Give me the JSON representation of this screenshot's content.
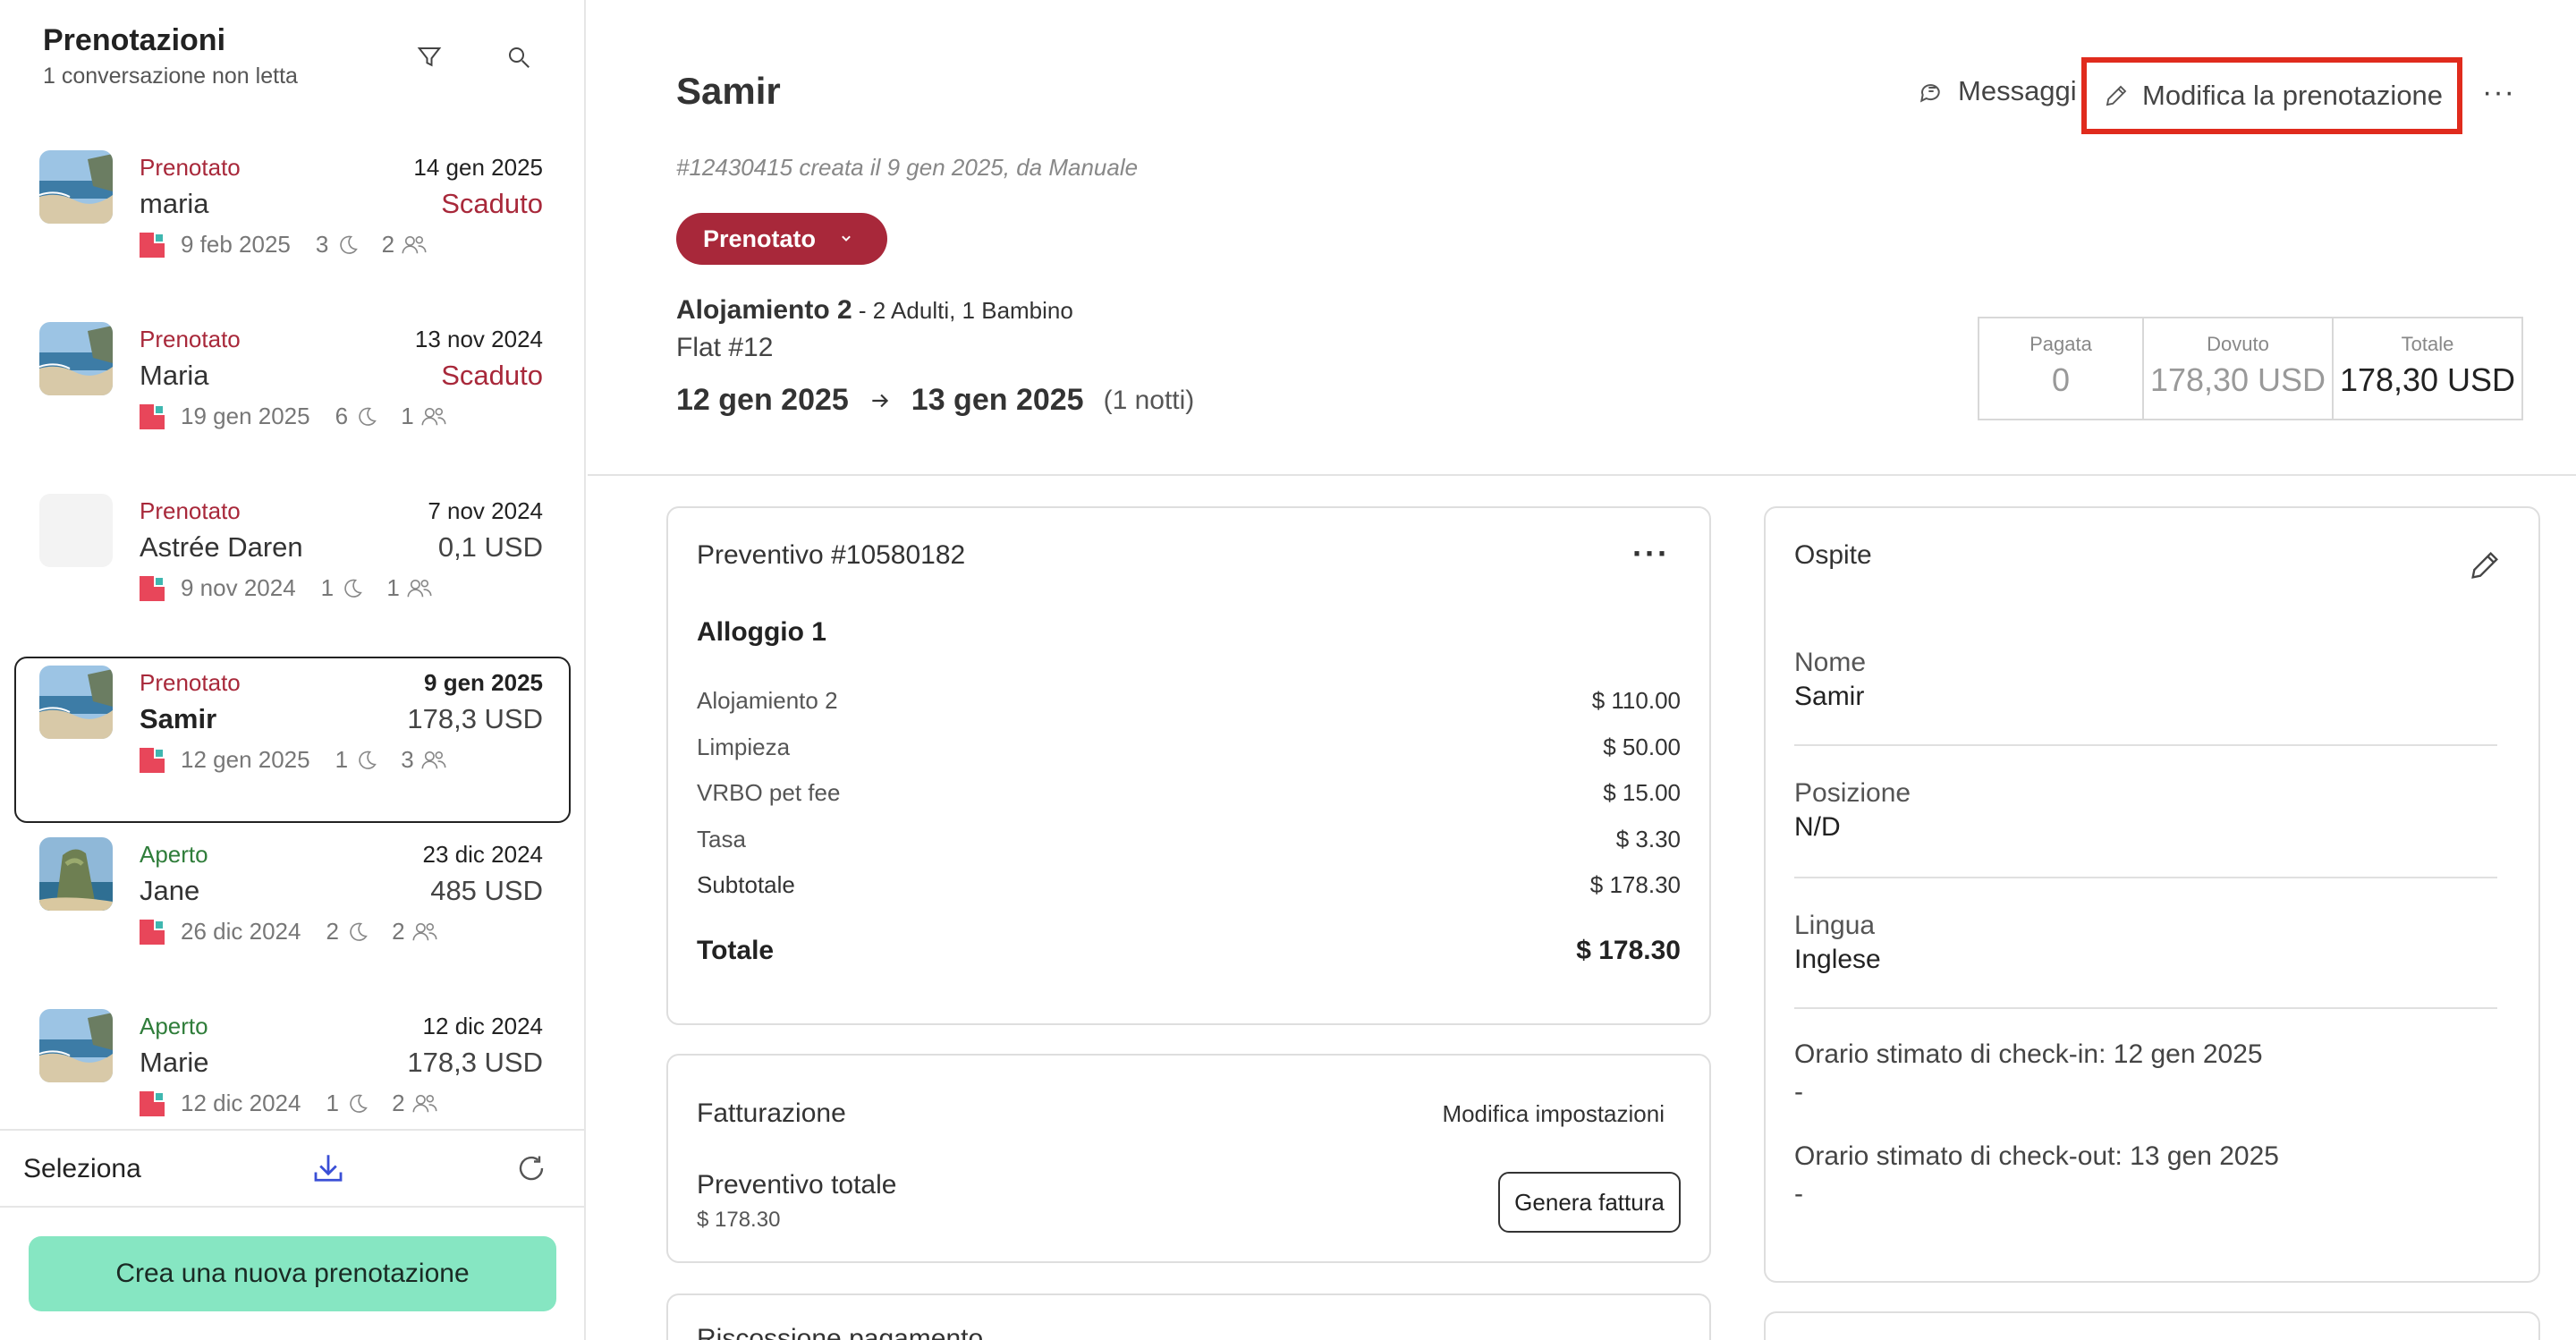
{
  "sidebar": {
    "title": "Prenotazioni",
    "subtitle": "1 conversazione non letta",
    "reservations": [
      {
        "status": "Prenotato",
        "status_kind": "prenotato",
        "date": "14 gen 2025",
        "name": "maria",
        "amount": "Scaduto",
        "amount_kind": "scaduto",
        "checkin": "9 feb 2025",
        "nights": "3",
        "guests": "2",
        "thumb": "beach"
      },
      {
        "status": "Prenotato",
        "status_kind": "prenotato",
        "date": "13 nov 2024",
        "name": "Maria",
        "amount": "Scaduto",
        "amount_kind": "scaduto",
        "checkin": "19 gen 2025",
        "nights": "6",
        "guests": "1",
        "thumb": "beach"
      },
      {
        "status": "Prenotato",
        "status_kind": "prenotato",
        "date": "7 nov 2024",
        "name": "Astrée Daren",
        "amount": "0,1 USD",
        "amount_kind": "normal",
        "checkin": "9 nov 2024",
        "nights": "1",
        "guests": "1",
        "thumb": "blank"
      },
      {
        "status": "Prenotato",
        "status_kind": "prenotato",
        "date": "9 gen 2025",
        "name": "Samir",
        "amount": "178,3 USD",
        "amount_kind": "normal",
        "checkin": "12 gen 2025",
        "nights": "1",
        "guests": "3",
        "thumb": "beach",
        "selected": true
      },
      {
        "status": "Aperto",
        "status_kind": "aperto",
        "date": "23 dic 2024",
        "name": "Jane",
        "amount": "485 USD",
        "amount_kind": "normal",
        "checkin": "26 dic 2024",
        "nights": "2",
        "guests": "2",
        "thumb": "cliff"
      },
      {
        "status": "Aperto",
        "status_kind": "aperto",
        "date": "12 dic 2024",
        "name": "Marie",
        "amount": "178,3 USD",
        "amount_kind": "normal",
        "checkin": "12 dic 2024",
        "nights": "1",
        "guests": "2",
        "thumb": "beach"
      }
    ],
    "select_label": "Seleziona",
    "new_button": "Crea una nuova prenotazione"
  },
  "header": {
    "guest_name": "Samir",
    "booking_meta": "#12430415 creata il 9 gen 2025, da Manuale",
    "status": "Prenotato",
    "unit_name": "Alojamiento 2",
    "unit_detail": " - 2 Adulti, 1 Bambino",
    "flat": "Flat #12",
    "checkin": "12 gen 2025",
    "checkout": "13 gen 2025",
    "nights": "(1 notti)",
    "messages_label": "Messaggi",
    "edit_label": "Modifica la prenotazione",
    "more_label": "···",
    "totals": [
      {
        "label": "Pagata",
        "value": "0",
        "kind": "muted"
      },
      {
        "label": "Dovuto",
        "value": "178,30 USD",
        "kind": "muted"
      },
      {
        "label": "Totale",
        "value": "178,30 USD",
        "kind": "total"
      }
    ]
  },
  "quote": {
    "title": "Preventivo #10580182",
    "section": "Alloggio 1",
    "lines": [
      {
        "label": "Alojamiento 2",
        "amount": "$ 110.00"
      },
      {
        "label": "Limpieza",
        "amount": "$ 50.00"
      },
      {
        "label": "VRBO pet fee",
        "amount": "$ 15.00"
      },
      {
        "label": "Tasa",
        "amount": "$ 3.30"
      },
      {
        "label": "Subtotale",
        "amount": "$ 178.30"
      }
    ],
    "total_label": "Totale",
    "total_amount": "$ 178.30"
  },
  "billing": {
    "title": "Fatturazione",
    "settings_label": "Modifica impostazioni",
    "quote_total_label": "Preventivo totale",
    "quote_total_amount": "$ 178.30",
    "invoice_button": "Genera fattura"
  },
  "payment": {
    "title": "Riscossione pagamento"
  },
  "guest": {
    "title": "Ospite",
    "name_label": "Nome",
    "name_value": "Samir",
    "position_label": "Posizione",
    "position_value": "N/D",
    "language_label": "Lingua",
    "language_value": "Inglese",
    "checkin_label": "Orario stimato di check-in: 12 gen 2025",
    "checkin_value": "-",
    "checkout_label": "Orario stimato di check-out: 13 gen 2025",
    "checkout_value": "-"
  },
  "icons": [
    "filter-icon",
    "search-icon",
    "download-icon",
    "refresh-icon",
    "chat-icon",
    "pencil-icon",
    "moon-icon",
    "people-icon",
    "vrbo-icon",
    "arrow-right-icon",
    "chevron-down-icon"
  ],
  "colors": {
    "status_booked": "#a8283a",
    "status_open": "#2f7d3a",
    "primary_button": "#86e6c2",
    "highlight": "#e02b1d"
  }
}
